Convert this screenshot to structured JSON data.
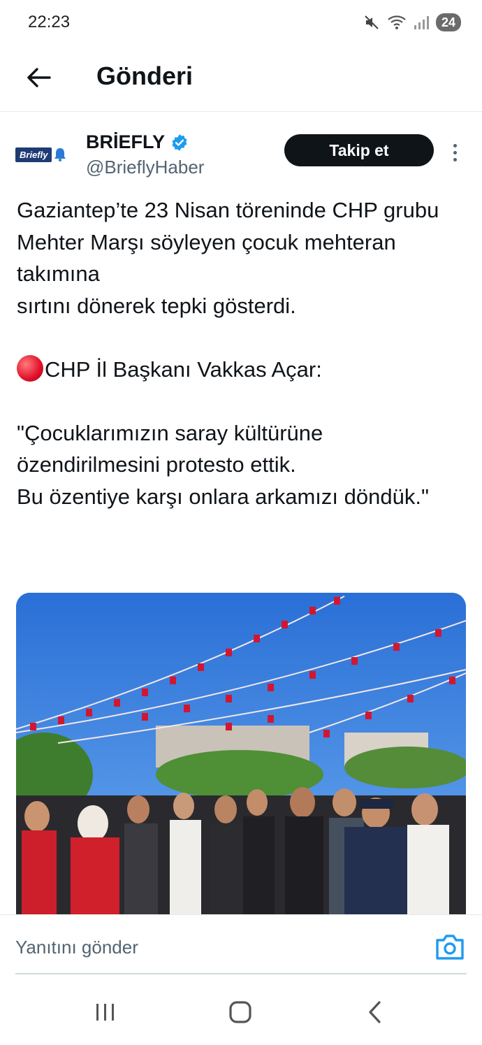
{
  "status_bar": {
    "time": "22:23",
    "battery": "24",
    "icons": [
      "mute-icon",
      "wifi-icon",
      "signal-icon",
      "battery-icon"
    ]
  },
  "header": {
    "title": "Gönderi",
    "back_icon": "arrow-left-icon"
  },
  "author": {
    "name": "BRİEFLY",
    "handle": "@BrieflyHaber",
    "verified": true,
    "avatar_text": "Briefly",
    "follow_label": "Takip et",
    "more_icon": "more-vertical-icon"
  },
  "tweet": {
    "lines": [
      "Gaziantep’te 23 Nisan töreninde CHP grubu",
      "Mehter Marşı söyleyen çocuk mehteran takımına",
      "sırtını dönerek tepki gösterdi.",
      "",
      "CHP İl Başkanı Vakkas Açar:",
      "",
      "\"Çocuklarımızın saray kültürüne özendirilmesini protesto ettik.",
      "Bu özentiye karşı onlara arkamızı döndük.\""
    ]
  },
  "media": {
    "type": "photo",
    "subject": "crowd-at-ceremony"
  },
  "reply": {
    "placeholder": "Yanıtını gönder",
    "camera_icon": "camera-icon"
  },
  "nav": {
    "icons": [
      "recent-apps-icon",
      "home-icon",
      "back-icon"
    ]
  },
  "colors": {
    "accent": "#1d9bf0",
    "text": "#0f1419",
    "secondary": "#536471"
  }
}
